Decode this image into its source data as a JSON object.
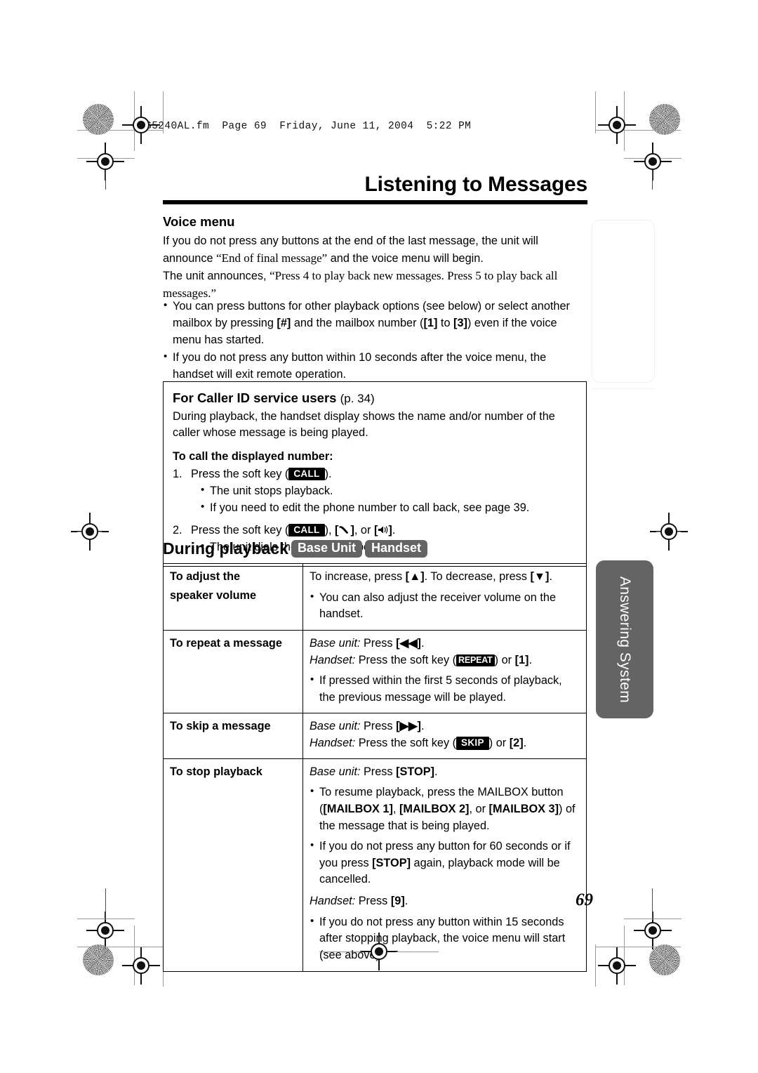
{
  "fm_header": "TG5240AL.fm  Page 69  Friday, June 11, 2004  5:22 PM",
  "chapter_title": "Listening to Messages",
  "page_number": "69",
  "side_tab": "Answering System",
  "voice_menu": {
    "heading": "Voice menu",
    "para1_a": "If you do not press any buttons at the end of the last message, the unit will announce ",
    "para1_quote": "“End of final message”",
    "para1_b": " and the voice menu will begin.",
    "para2_a": "The unit announces, ",
    "para2_quote": "“Press 4 to play back new messages. Press 5 to play back all messages.”",
    "bullets": [
      {
        "s1": "You can press buttons for other playback options (see below) or select another mailbox by pressing ",
        "k1": "[#]",
        "s2": " and the mailbox number (",
        "k2": "[1]",
        "s3": " to ",
        "k3": "[3]",
        "s4": ") even if the voice menu has started."
      },
      {
        "s1": "If you do not press any button within 10 seconds after the voice menu, the handset will exit remote operation."
      }
    ]
  },
  "caller_id_box": {
    "heading": "For Caller ID service users",
    "heading_page": "(p. 34)",
    "intro": "During playback, the handset display shows the name and/or number of the caller whose message is being played.",
    "sub_head": "To call the displayed number:",
    "steps": [
      {
        "num": "1.",
        "text_a": "Press the soft key (",
        "key": "CALL",
        "text_b": ").",
        "bullets": [
          "The unit stops playback.",
          "If you need to edit the phone number to call back, see page 39."
        ]
      },
      {
        "num": "2.",
        "text_a": "Press the soft key (",
        "key": "CALL",
        "text_b": "), ",
        "icon_talk": "[✆]",
        "text_c": ", or ",
        "icon_speaker": "[ὐA]",
        "text_d": ".",
        "bullets": [
          "The unit dials the phone number."
        ]
      }
    ]
  },
  "during_playback": {
    "heading": "During playback",
    "badge_base": "Base Unit",
    "badge_handset": "Handset",
    "rows": [
      {
        "key_line1": "To adjust the",
        "key_line2": "speaker volume",
        "lines": [
          {
            "a": "To increase, press ",
            "k": "[▲]",
            "b": ". To decrease, press ",
            "k2": "[▼]",
            "c": "."
          }
        ],
        "bullets": [
          "You can also adjust the receiver volume on the handset."
        ]
      },
      {
        "key_line1": "To repeat a message",
        "lines": [
          {
            "label": "Base unit:",
            "a": " Press ",
            "k": "[◀◀]",
            "c": "."
          },
          {
            "label": "Handset:",
            "a": " Press the soft key (",
            "softkey": "REPEAT",
            "b": ") or ",
            "k": "[1]",
            "c": "."
          }
        ],
        "bullets": [
          "If pressed within the first 5 seconds of playback, the previous message will be played."
        ]
      },
      {
        "key_line1": "To skip a message",
        "lines": [
          {
            "label": "Base unit:",
            "a": " Press ",
            "k": "[▶▶]",
            "c": "."
          },
          {
            "label": "Handset:",
            "a": " Press the soft key (",
            "softkey": "SKIP",
            "b": ") or ",
            "k": "[2]",
            "c": "."
          }
        ],
        "bullets": []
      },
      {
        "key_line1": "To stop playback",
        "lines": [
          {
            "label": "Base unit:",
            "a": " Press ",
            "k": "[STOP]",
            "c": "."
          }
        ],
        "bullets_rich": [
          {
            "s1": "To resume playback, press the MAILBOX button (",
            "k1": "[MAILBOX 1]",
            "s2": ", ",
            "k2": "[MAILBOX 2]",
            "s3": ", or ",
            "k3": "[MAILBOX 3]",
            "s4": ") of the message that is being played."
          },
          {
            "s1": "If you do not press any button for 60 seconds or if you press ",
            "k1": "[STOP]",
            "s2": " again, playback mode will be cancelled."
          }
        ],
        "lines2": [
          {
            "label": "Handset:",
            "a": " Press ",
            "k": "[9]",
            "c": "."
          }
        ],
        "bullets2": [
          "If you do not press any button within 15 seconds after stopping playback, the voice menu will start (see above)."
        ]
      }
    ]
  }
}
